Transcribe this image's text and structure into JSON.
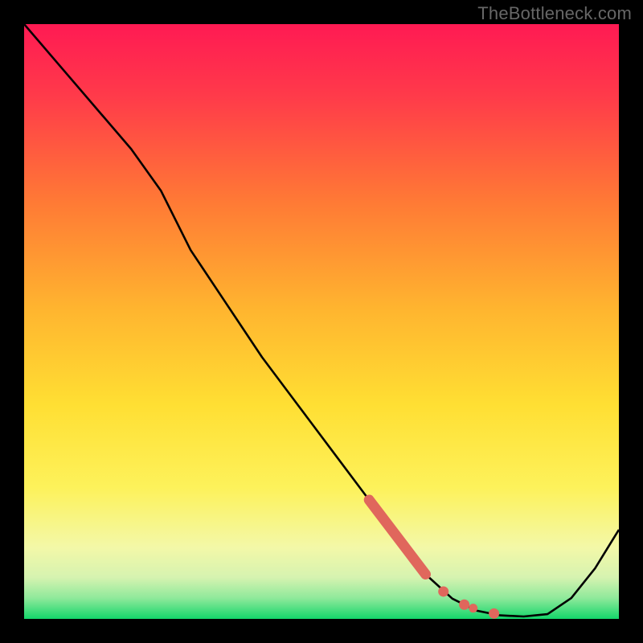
{
  "watermark": "TheBottleneck.com",
  "colors": {
    "frame": "#000000",
    "watermark": "#676767",
    "line": "#000000",
    "marker": "#e0675c",
    "grad_top": "#ff1a53",
    "grad_mid1": "#ff8a2a",
    "grad_mid2": "#ffe63a",
    "grad_mid3": "#f4f99b",
    "grad_bot": "#15d66a"
  },
  "chart_data": {
    "type": "line",
    "title": "",
    "xlabel": "",
    "ylabel": "",
    "xlim": [
      0,
      100
    ],
    "ylim": [
      0,
      100
    ],
    "note": "No axes, ticks, or legend visible. Curve read off pixel positions; x/y are % of plot width/height from bottom-left.",
    "series": [
      {
        "name": "curve",
        "x": [
          0,
          6,
          12,
          18,
          23,
          28,
          34,
          40,
          46,
          52,
          58,
          63,
          67.5,
          72,
          76,
          80,
          84,
          88,
          92,
          96,
          100
        ],
        "y": [
          100,
          93,
          86,
          79,
          72,
          62,
          53,
          44,
          36,
          28,
          20,
          13,
          7.5,
          3.4,
          1.4,
          0.6,
          0.4,
          0.8,
          3.5,
          8.5,
          15
        ]
      }
    ],
    "markers": {
      "name": "highlight-dots",
      "thick_segment": {
        "x": [
          58,
          67.5
        ],
        "y": [
          20,
          7.5
        ]
      },
      "dots": [
        {
          "x": 70.5,
          "y": 4.6
        },
        {
          "x": 74.0,
          "y": 2.4
        },
        {
          "x": 75.5,
          "y": 1.8
        },
        {
          "x": 79.0,
          "y": 0.9
        }
      ]
    }
  }
}
